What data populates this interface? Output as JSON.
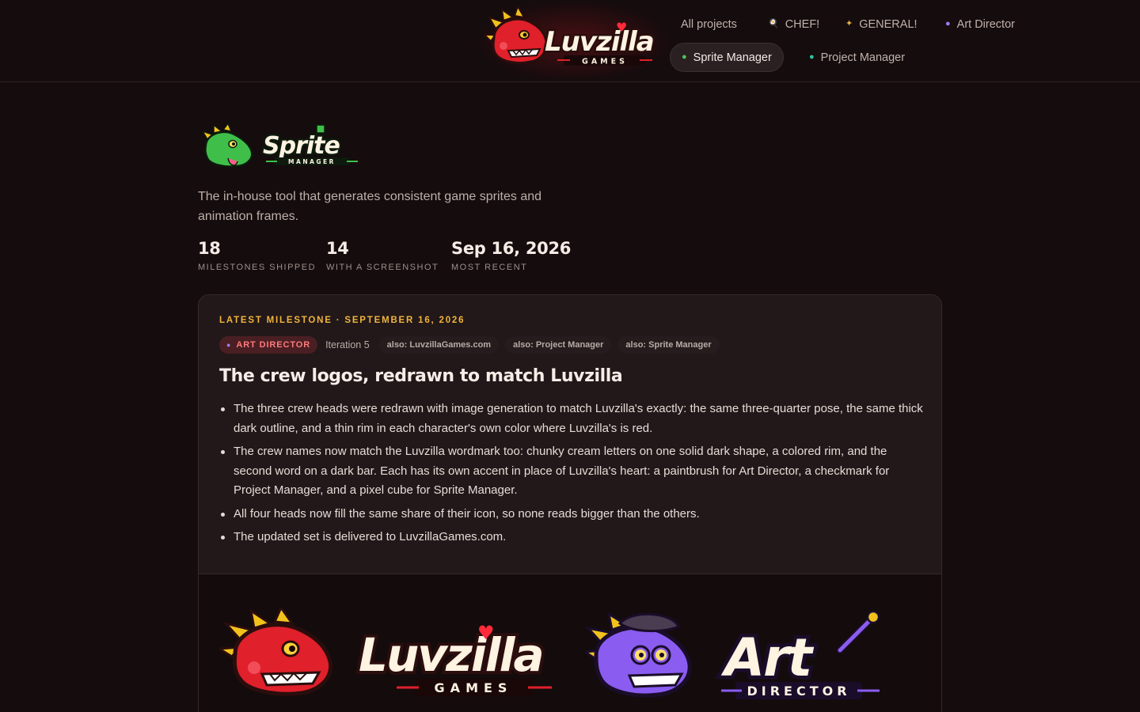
{
  "header": {
    "brand": {
      "wordmark": "Luvzilla",
      "subtitle": "GAMES"
    },
    "nav": [
      {
        "label": "All projects",
        "icon": "",
        "active": false
      },
      {
        "label": "CHEF!",
        "icon": "chef-icon",
        "active": false
      },
      {
        "label": "GENERAL!",
        "icon": "general-icon",
        "active": false
      },
      {
        "label": "Art Director",
        "icon": "art-director-icon",
        "active": false
      },
      {
        "label": "Sprite Manager",
        "icon": "sprite-manager-icon",
        "active": true
      },
      {
        "label": "Project Manager",
        "icon": "project-manager-icon",
        "active": false
      }
    ]
  },
  "project": {
    "logo": {
      "wordmark": "Sprite",
      "subtitle": "MANAGER"
    },
    "description": "The in-house tool that generates consistent game sprites and animation frames.",
    "stats": [
      {
        "value": "18",
        "label": "MILESTONES SHIPPED"
      },
      {
        "value": "14",
        "label": "WITH A SCREENSHOT"
      },
      {
        "value": "Sep 16, 2026",
        "label": "MOST RECENT"
      }
    ]
  },
  "milestone": {
    "kicker": "LATEST MILESTONE · SEPTEMBER 16, 2026",
    "role_tag": "ART DIRECTOR",
    "iteration": "Iteration 5",
    "also_tags": [
      "also: LuvzillaGames.com",
      "also: Project Manager",
      "also: Sprite Manager"
    ],
    "title": "The crew logos, redrawn to match Luvzilla",
    "bullets": [
      "The three crew heads were redrawn with image generation to match Luvzilla's exactly: the same three-quarter pose, the same thick dark outline, and a thin rim in each character's own color where Luvzilla's is red.",
      "The crew names now match the Luvzilla wordmark too: chunky cream letters on one solid dark shape, a colored rim, and the second word on a dark bar. Each has its own accent in place of Luvzilla's heart: a paintbrush for Art Director, a checkmark for Project Manager, and a pixel cube for Sprite Manager.",
      "All four heads now fill the same share of their icon, so none reads bigger than the others.",
      "The updated set is delivered to LuvzillaGames.com."
    ],
    "screenshot": {
      "logos": [
        {
          "wordmark": "Luvzilla",
          "subtitle": "GAMES"
        },
        {
          "wordmark": "Art",
          "subtitle": "DIRECTOR"
        }
      ]
    }
  },
  "colors": {
    "background": "#150c0d",
    "card": "#221819",
    "accent_gold": "#f0b43c",
    "luvzilla_red": "#e0202a",
    "art_purple": "#8a5cf0",
    "sprite_green": "#3fbf4a"
  }
}
